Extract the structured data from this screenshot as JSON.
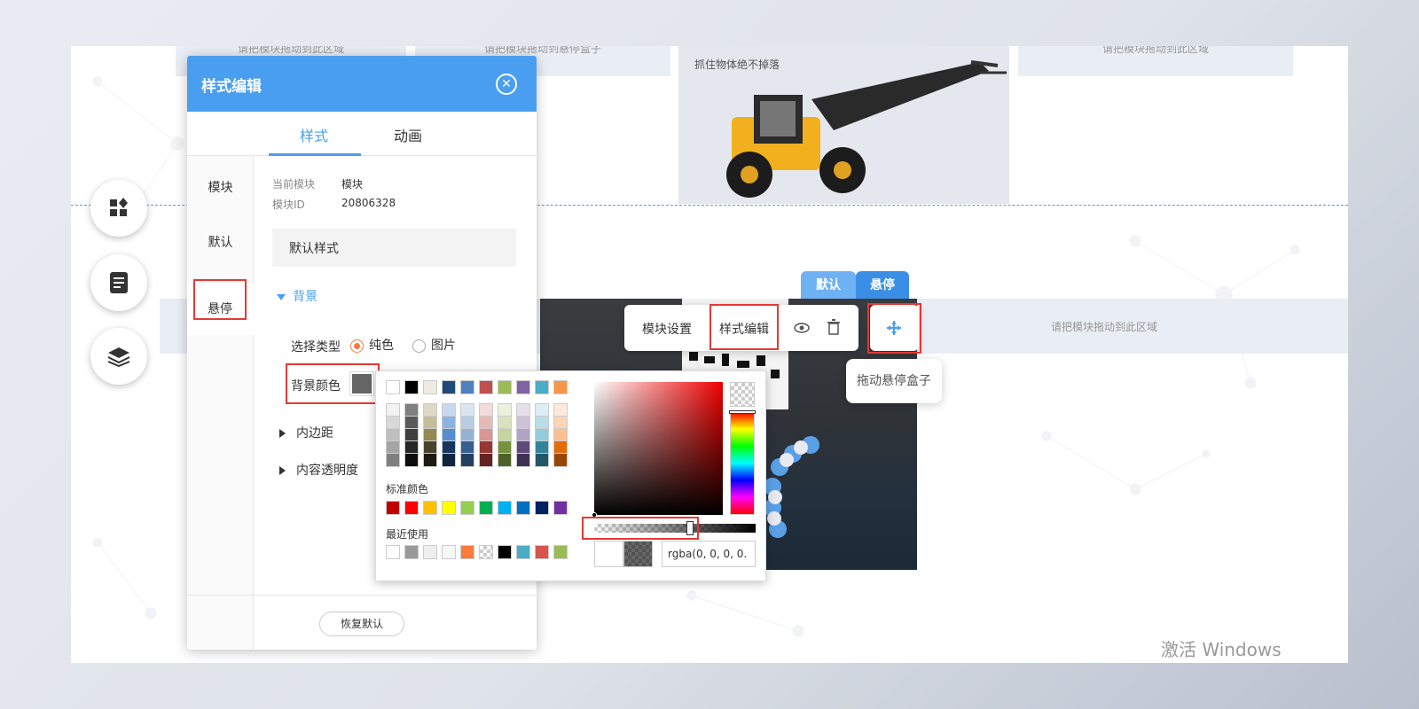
{
  "drop_zone_text": "请把模块拖动到此区域",
  "hover_zone_text": "请把模块拖动到悬停盒子",
  "photo_caption": "抓住物体绝不掉落",
  "dialog": {
    "title": "样式编辑",
    "close_icon": "close-icon",
    "tabs": [
      "样式",
      "动画"
    ],
    "side_items": [
      "模块",
      "默认",
      "悬停"
    ],
    "current_module_label": "当前模块",
    "current_module_value": "模块",
    "module_id_label": "模块ID",
    "module_id_value": "20806328",
    "preset": "默认样式",
    "background_section": "背景",
    "select_type_label": "选择类型",
    "type_options": [
      "纯色",
      "图片"
    ],
    "bg_color_label": "背景颜色",
    "bg_color_value": "#666666",
    "padding_section": "内边距",
    "opacity_section": "内容透明度",
    "reset_button": "恢复默认"
  },
  "color_picker": {
    "top_row": [
      "#ffffff",
      "#000000",
      "#eeece1",
      "#1f497d",
      "#4f81bd",
      "#c0504d",
      "#9bbb59",
      "#8064a2",
      "#4bacc6",
      "#f79646"
    ],
    "shades": [
      [
        "#f2f2f2",
        "#7f7f7f",
        "#ddd9c3",
        "#c6d9f0",
        "#dbe5f1",
        "#f2dcdb",
        "#ebf1dd",
        "#e5e0ec",
        "#dbeef3",
        "#fdeada"
      ],
      [
        "#d8d8d8",
        "#595959",
        "#c4bd97",
        "#8db3e2",
        "#b8cce4",
        "#e5b9b7",
        "#d7e3bc",
        "#ccc1d9",
        "#b7dde8",
        "#fbd5b5"
      ],
      [
        "#bfbfbf",
        "#3f3f3f",
        "#938953",
        "#548dd4",
        "#95b3d7",
        "#d99694",
        "#c3d69b",
        "#b2a2c7",
        "#92cddc",
        "#fac08f"
      ],
      [
        "#a5a5a5",
        "#262626",
        "#494429",
        "#17365d",
        "#366092",
        "#953734",
        "#76923c",
        "#5f497a",
        "#31859b",
        "#e36c09"
      ],
      [
        "#7f7f7f",
        "#0c0c0c",
        "#1d1b10",
        "#0f243e",
        "#244061",
        "#632423",
        "#4f6128",
        "#3f3151",
        "#205867",
        "#974806"
      ]
    ],
    "standard_label": "标准颜色",
    "standard": [
      "#c00000",
      "#ff0000",
      "#ffc000",
      "#ffff00",
      "#92d050",
      "#00b050",
      "#00b0f0",
      "#0070c0",
      "#002060",
      "#7030a0"
    ],
    "recent_label": "最近使用",
    "recent": [
      "#ffffff",
      "#999999",
      "#eeeeee",
      "#f7f7f7",
      "#ff7a3d",
      "checker",
      "#000000",
      "#4bacc6",
      "#d9534f",
      "#9bbb59"
    ],
    "alpha_fraction": 0.6,
    "rgba_value": "rgba(0, 0, 0, 0."
  },
  "toolbar": {
    "module_settings": "模块设置",
    "style_edit": "样式编辑",
    "preview_icon": "eye-icon",
    "delete_icon": "trash-icon",
    "move_icon": "move-icon"
  },
  "state_tabs": [
    "默认",
    "悬停"
  ],
  "tooltip": "拖动悬停盒子",
  "watermark": "激活 Windows",
  "fab_icons": [
    "add-module-icon",
    "page-icon",
    "layers-icon"
  ]
}
